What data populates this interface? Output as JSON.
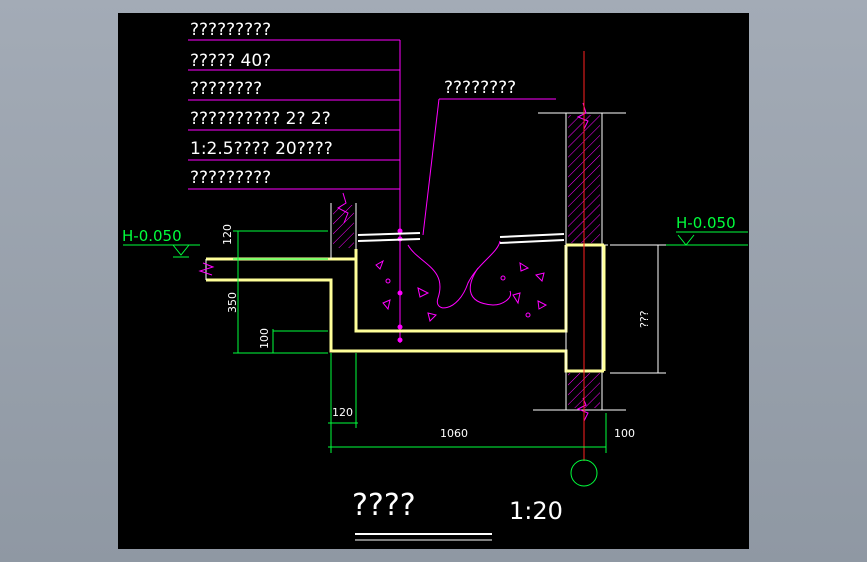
{
  "notes": [
    "?????????",
    "?????  40?",
    "????????",
    "??????????   2? 2?",
    "1:2.5????  20????",
    "?????????"
  ],
  "callout_label": "????????",
  "levels": {
    "left": "H-0.050",
    "right": "H-0.050"
  },
  "dimensions": {
    "d120_top": "120",
    "d350": "350",
    "d100_left": "100",
    "d120_bottom": "120",
    "d1060": "1060",
    "d100_right": "100",
    "right_height": "???"
  },
  "title": "????",
  "scale": "1:20",
  "colors": {
    "background": "#000000",
    "frame": "#9aa2ad",
    "leader": "#ff00ff",
    "wall": "#ffff99",
    "dimension": "#00ff3c",
    "axis": "#ff2020",
    "hatch": "#ff00ff"
  }
}
